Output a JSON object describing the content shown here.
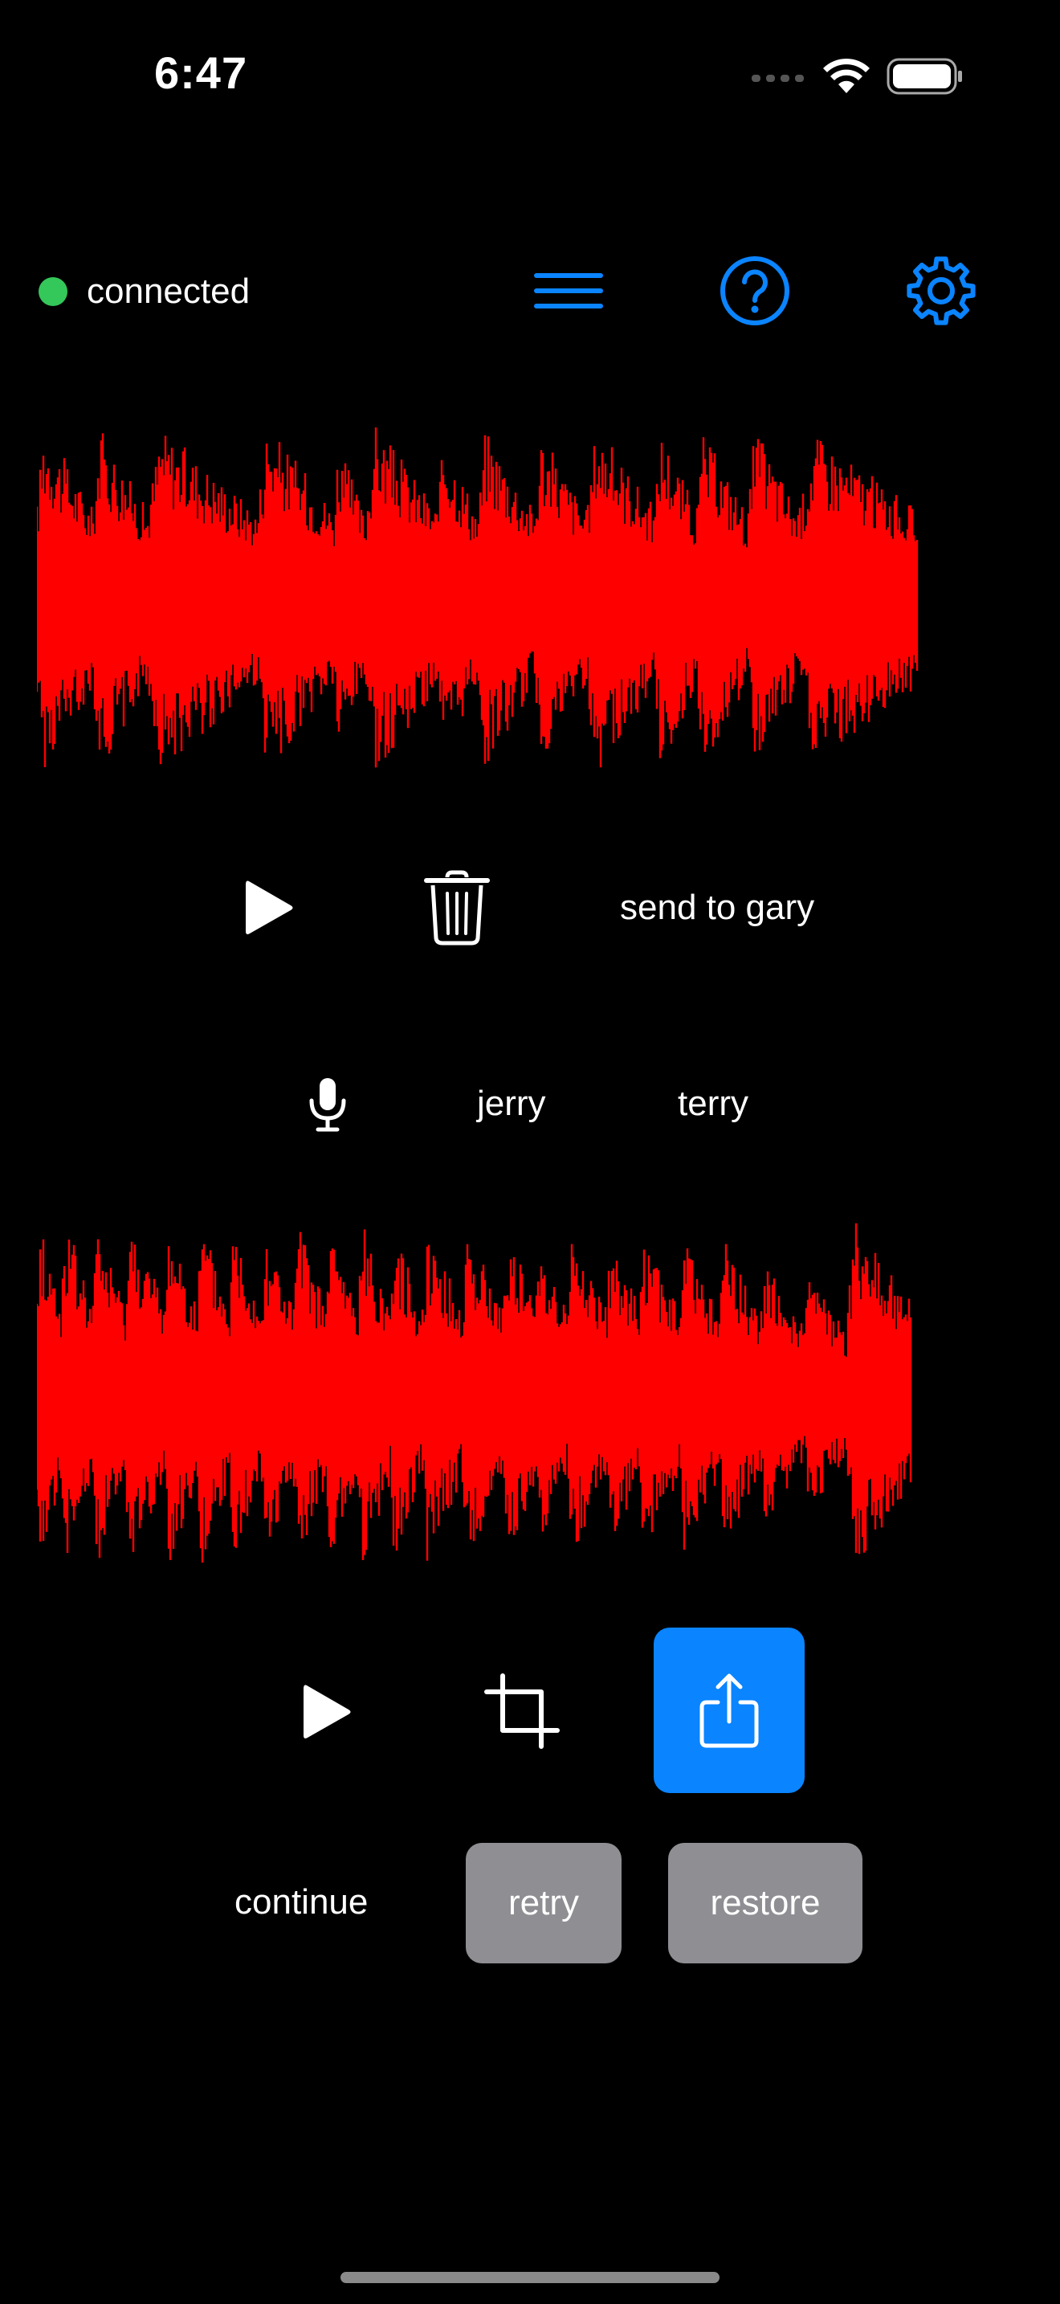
{
  "status_bar": {
    "time": "6:47",
    "icons": [
      "cellular-signal-icon",
      "wifi-icon",
      "battery-icon"
    ]
  },
  "header": {
    "connection_status": "connected",
    "connection_color": "#34c759",
    "icons": [
      "menu-icon",
      "help-icon",
      "gear-icon"
    ],
    "accent_color": "#0a84ff"
  },
  "waveform_color": "#ff0000",
  "section_one": {
    "icons": [
      "play-icon",
      "trash-icon"
    ],
    "send_label": "send to gary"
  },
  "section_two": {
    "icons": [
      "microphone-icon"
    ],
    "voice_one": "jerry",
    "voice_two": "terry"
  },
  "section_three": {
    "icons": [
      "play-icon",
      "crop-icon",
      "share-icon"
    ],
    "share_button_color": "#0a84ff"
  },
  "actions": {
    "continue_label": "continue",
    "retry_label": "retry",
    "restore_label": "restore"
  }
}
